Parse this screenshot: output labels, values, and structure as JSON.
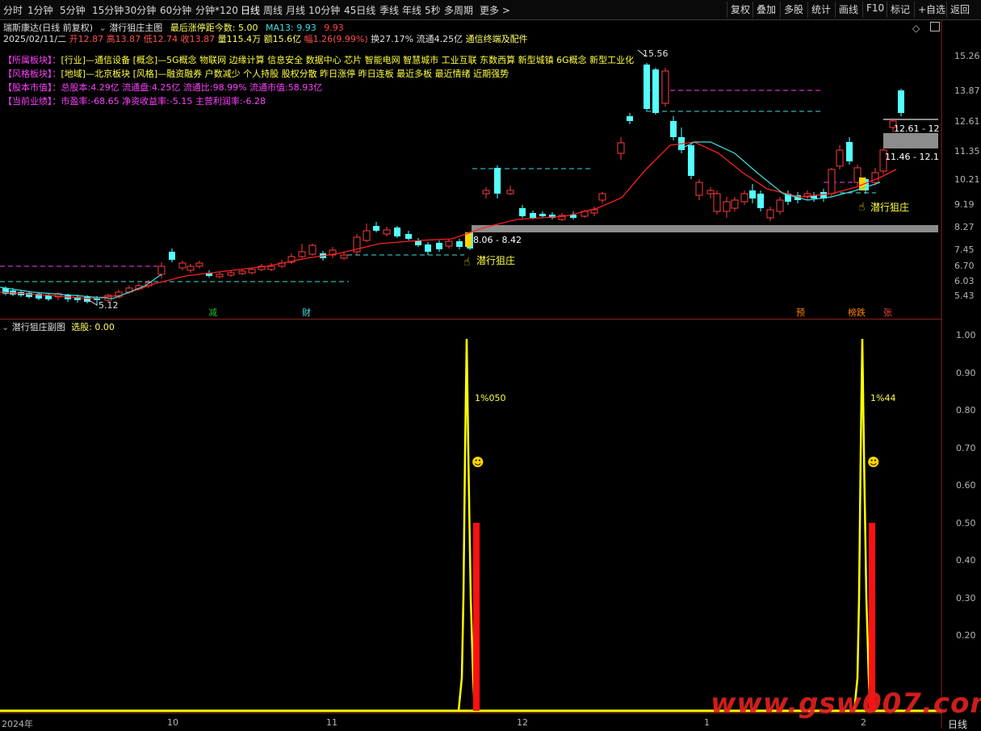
{
  "toolbar": {
    "periods": [
      "分时",
      "1分钟",
      "5分钟",
      "15分钟",
      "30分钟",
      "60分钟",
      "分钟*120",
      "日线",
      "周线",
      "月线",
      "10分钟",
      "45日线",
      "季线",
      "年线",
      "5秒",
      "多周期",
      "更多 >"
    ],
    "active": "日线",
    "right": [
      "复权",
      "叠加",
      "多股",
      "统计",
      "画线",
      "F10",
      "标记",
      "+自选",
      "返回"
    ]
  },
  "header": {
    "stock": "瑞斯康达(日线 前复权)",
    "indicator": "潜行狙庄主图",
    "last_limit_label": "最后涨停距今数: 5.00",
    "ma_label": "MA13: 9.93",
    "ma_value2": "9.93",
    "date": "2025/02/11/二",
    "open": "开12.87",
    "high": "高13.87",
    "low": "低12.74",
    "close": "收13.87",
    "volume": "量115.4万",
    "amount": "额15.6亿",
    "change": "幅1.26(9.99%)",
    "turnover": "换27.17%",
    "float": "流通4.25亿",
    "link": "通信终端及配件"
  },
  "info_lines": [
    {
      "label": "【所属板块】：",
      "text": "[行业]—通信设备 [概念]—5G概念 物联网 边缘计算 信息安全 数据中心 芯片 智能电网 智慧城市 工业互联 东数西算 新型城镇 6G概念 新型工业化"
    },
    {
      "label": "【风格板块】：",
      "text": "[地域]—北京板块 [风格]—融资融券 户数减少 个人持股 股权分散 昨日涨停 昨日连板 最近多板 最近情绪 近期强势"
    },
    {
      "label": "【股本市值】：",
      "text": "总股本:4.29亿 流通盘:4.25亿 流通比:98.99% 流通市值:58.93亿"
    },
    {
      "label": "【当前业绩】：",
      "text": "市盈率:-68.65 净资收益率:-5.15 主营利润率:-6.28"
    }
  ],
  "main_axis": [
    "15.26",
    "13.87",
    "12.61",
    "11.35",
    "10.21",
    "9.19",
    "8.27",
    "7.45",
    "6.70",
    "6.03",
    "5.43"
  ],
  "annotations": {
    "high_label": "15.56",
    "low_label": "5.12",
    "box1": "8.06 - 8.42",
    "box2": "12.61 - 12",
    "box3": "11.46 - 12.1",
    "signal1": "潜行狙庄",
    "signal2": "潜行狙庄",
    "markers": [
      "减",
      "财",
      "预",
      "榜跌",
      "张"
    ]
  },
  "sub": {
    "title": "潜行狙庄副图",
    "pick_label": "选股: 0.00",
    "axis": [
      "1.00",
      "0.90",
      "0.80",
      "0.70",
      "0.60",
      "0.50",
      "0.40",
      "0.30",
      "0.20"
    ],
    "peak1_label": "1%050",
    "peak2_label": "1%44",
    "smiley": "☻"
  },
  "time_axis": [
    "2024年",
    "10",
    "11",
    "12",
    "1",
    "2"
  ],
  "bottom_right": "日线",
  "watermark": "www.gsw007.com",
  "colors": {
    "up": "#ff3c3c",
    "down": "#54ffff",
    "ma": "#ff2020",
    "cyan_line": "#40e0e0",
    "yellow": "#ffff00",
    "magenta": "#ff40ff",
    "gray_box": "#8c8c8c"
  }
}
